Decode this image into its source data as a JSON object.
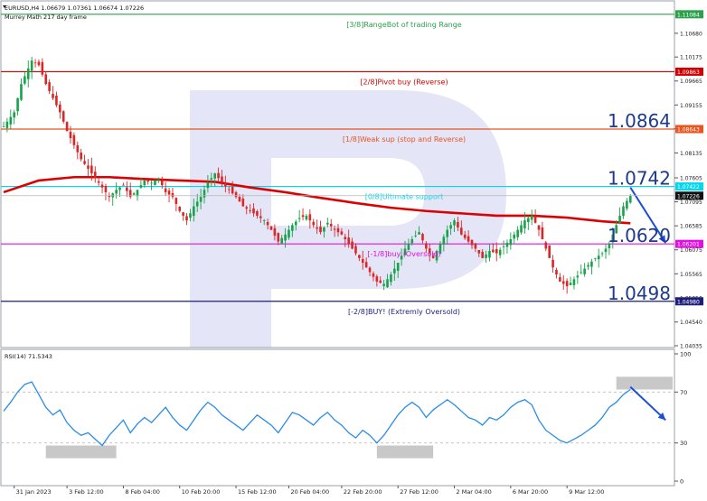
{
  "header": {
    "symbol_line": "EURUSD,H4  1.06679 1.07361 1.06674 1.07226",
    "indicator_label": "Murrey Math 217 day frame"
  },
  "colors": {
    "bull": "#16a34a",
    "bear": "#dc2626",
    "ma": "#dc0000",
    "rsi": "#2b8ce8",
    "forecast_arrow": "#1d4ed8",
    "watermark": "#e4e5f6"
  },
  "price_axis": {
    "min": 1.04035,
    "max": 1.1133,
    "ticks": [
      "1.10680",
      "1.10175",
      "1.09665",
      "1.09155",
      "1.08650",
      "1.08135",
      "1.07605",
      "1.07095",
      "1.06585",
      "1.06075",
      "1.05565",
      "1.05050",
      "1.04540",
      "1.04035"
    ],
    "current_price": "1.07226",
    "current_price_color": "#6b7280"
  },
  "murrey_levels": [
    {
      "label": "[3/8]RangeBot of trading Range",
      "price": 1.11084,
      "badge": "1.11084",
      "color": "#2aa14a",
      "label_pos": "center"
    },
    {
      "label": "[2/8]Pivot buy (Reverse)",
      "price": 1.09863,
      "badge": "1.09863",
      "color": "#d10000",
      "label_pos": "center"
    },
    {
      "label": "[1/8]Weak sup (stop and Reverse)",
      "price": 1.08643,
      "badge": "1.08643",
      "color": "#e8551e",
      "label_pos": "center"
    },
    {
      "label": "[0/8]Ultimate support",
      "price": 1.07422,
      "badge": "1.07422",
      "color": "#00d8f0",
      "label_pos": "center"
    },
    {
      "label": "[-1/8]buy (Oversold)",
      "price": 1.06201,
      "badge": "1.06201",
      "color": "#e010e0",
      "label_pos": "center"
    },
    {
      "label": "[-2/8]BUY! (Extremly Oversold)",
      "price": 1.0498,
      "badge": "1.04980",
      "color": "#1e1e7a",
      "label_pos": "center"
    }
  ],
  "big_levels": [
    "1.0864",
    "1.0742",
    "1.0620",
    "1.0498"
  ],
  "rsi_panel": {
    "label": "RSI(14) 71.5343",
    "ticks": [
      "100",
      "70",
      "30",
      "0"
    ],
    "min": 0,
    "max": 100
  },
  "time_axis": {
    "labels": [
      "31 Jan 2023",
      "3 Feb 12:00",
      "8 Feb 04:00",
      "10 Feb 20:00",
      "15 Feb 12:00",
      "20 Feb 04:00",
      "22 Feb 20:00",
      "27 Feb 12:00",
      "2 Mar 04:00",
      "6 Mar 20:00",
      "9 Mar 12:00"
    ]
  },
  "chart_data": {
    "type": "candlestick",
    "title": "EURUSD,H4",
    "x_unit": "H4 bar index",
    "price_range": [
      1.04035,
      1.1133
    ],
    "moving_average_label": "Murrey Math 217 day frame",
    "murrey_levels": [
      1.11084,
      1.09863,
      1.08643,
      1.07422,
      1.06201,
      1.0498
    ],
    "close_path": [
      [
        0,
        1.087
      ],
      [
        3,
        1.09
      ],
      [
        5,
        1.096
      ],
      [
        8,
        1.101
      ],
      [
        10,
        1.1
      ],
      [
        12,
        1.096
      ],
      [
        14,
        1.093
      ],
      [
        16,
        1.09
      ],
      [
        18,
        1.086
      ],
      [
        20,
        1.083
      ],
      [
        22,
        1.08
      ],
      [
        24,
        1.078
      ],
      [
        26,
        1.076
      ],
      [
        28,
        1.074
      ],
      [
        30,
        1.072
      ],
      [
        32,
        1.0735
      ],
      [
        34,
        1.0745
      ],
      [
        36,
        1.072
      ],
      [
        38,
        1.0735
      ],
      [
        40,
        1.0755
      ],
      [
        42,
        1.075
      ],
      [
        44,
        1.076
      ],
      [
        46,
        1.073
      ],
      [
        48,
        1.072
      ],
      [
        50,
        1.069
      ],
      [
        52,
        1.067
      ],
      [
        54,
        1.07
      ],
      [
        56,
        1.072
      ],
      [
        58,
        1.075
      ],
      [
        60,
        1.077
      ],
      [
        62,
        1.075
      ],
      [
        64,
        1.0735
      ],
      [
        66,
        1.072
      ],
      [
        68,
        1.07
      ],
      [
        70,
        1.069
      ],
      [
        72,
        1.068
      ],
      [
        74,
        1.067
      ],
      [
        76,
        1.065
      ],
      [
        78,
        1.0625
      ],
      [
        80,
        1.064
      ],
      [
        82,
        1.066
      ],
      [
        84,
        1.0675
      ],
      [
        86,
        1.068
      ],
      [
        88,
        1.066
      ],
      [
        90,
        1.0645
      ],
      [
        92,
        1.0665
      ],
      [
        94,
        1.065
      ],
      [
        96,
        1.064
      ],
      [
        98,
        1.062
      ],
      [
        100,
        1.06
      ],
      [
        102,
        1.058
      ],
      [
        104,
        1.056
      ],
      [
        106,
        1.054
      ],
      [
        108,
        1.0535
      ],
      [
        110,
        1.0555
      ],
      [
        112,
        1.058
      ],
      [
        114,
        1.061
      ],
      [
        116,
        1.063
      ],
      [
        118,
        1.0645
      ],
      [
        120,
        1.061
      ],
      [
        122,
        1.059
      ],
      [
        124,
        1.062
      ],
      [
        126,
        1.065
      ],
      [
        128,
        1.067
      ],
      [
        130,
        1.064
      ],
      [
        132,
        1.0625
      ],
      [
        134,
        1.061
      ],
      [
        136,
        1.059
      ],
      [
        138,
        1.0605
      ],
      [
        140,
        1.06
      ],
      [
        142,
        1.0615
      ],
      [
        144,
        1.063
      ],
      [
        146,
        1.065
      ],
      [
        148,
        1.067
      ],
      [
        150,
        1.068
      ],
      [
        152,
        1.065
      ],
      [
        154,
        1.061
      ],
      [
        156,
        1.057
      ],
      [
        158,
        1.054
      ],
      [
        160,
        1.053
      ],
      [
        162,
        1.0545
      ],
      [
        164,
        1.056
      ],
      [
        166,
        1.0575
      ],
      [
        168,
        1.059
      ],
      [
        170,
        1.06
      ],
      [
        172,
        1.062
      ],
      [
        174,
        1.066
      ],
      [
        176,
        1.07
      ],
      [
        178,
        1.0723
      ]
    ],
    "moving_average": [
      [
        0,
        1.073
      ],
      [
        10,
        1.0755
      ],
      [
        20,
        1.0762
      ],
      [
        30,
        1.0762
      ],
      [
        40,
        1.0758
      ],
      [
        50,
        1.0755
      ],
      [
        60,
        1.0752
      ],
      [
        70,
        1.074
      ],
      [
        80,
        1.073
      ],
      [
        90,
        1.0718
      ],
      [
        100,
        1.0707
      ],
      [
        110,
        1.0697
      ],
      [
        120,
        1.069
      ],
      [
        130,
        1.0685
      ],
      [
        140,
        1.068
      ],
      [
        150,
        1.068
      ],
      [
        160,
        1.0676
      ],
      [
        170,
        1.0668
      ],
      [
        178,
        1.0664
      ]
    ],
    "forecast": {
      "from": [
        178,
        1.074
      ],
      "to": [
        188,
        1.0622
      ],
      "direction": "down"
    },
    "rsi": {
      "name": "RSI(14)",
      "last": 71.5343,
      "levels": [
        70,
        30
      ],
      "values": [
        [
          0,
          55
        ],
        [
          2,
          62
        ],
        [
          4,
          70
        ],
        [
          6,
          76
        ],
        [
          8,
          78
        ],
        [
          10,
          68
        ],
        [
          12,
          58
        ],
        [
          14,
          52
        ],
        [
          16,
          56
        ],
        [
          18,
          46
        ],
        [
          20,
          40
        ],
        [
          22,
          36
        ],
        [
          24,
          38
        ],
        [
          26,
          33
        ],
        [
          28,
          28
        ],
        [
          30,
          36
        ],
        [
          32,
          42
        ],
        [
          34,
          48
        ],
        [
          36,
          38
        ],
        [
          38,
          45
        ],
        [
          40,
          50
        ],
        [
          42,
          46
        ],
        [
          44,
          52
        ],
        [
          46,
          58
        ],
        [
          48,
          50
        ],
        [
          50,
          44
        ],
        [
          52,
          40
        ],
        [
          54,
          48
        ],
        [
          56,
          56
        ],
        [
          58,
          62
        ],
        [
          60,
          58
        ],
        [
          62,
          52
        ],
        [
          64,
          48
        ],
        [
          66,
          44
        ],
        [
          68,
          40
        ],
        [
          70,
          46
        ],
        [
          72,
          52
        ],
        [
          74,
          48
        ],
        [
          76,
          44
        ],
        [
          78,
          38
        ],
        [
          80,
          46
        ],
        [
          82,
          54
        ],
        [
          84,
          52
        ],
        [
          86,
          48
        ],
        [
          88,
          44
        ],
        [
          90,
          50
        ],
        [
          92,
          54
        ],
        [
          94,
          48
        ],
        [
          96,
          44
        ],
        [
          98,
          38
        ],
        [
          100,
          34
        ],
        [
          102,
          40
        ],
        [
          104,
          36
        ],
        [
          106,
          30
        ],
        [
          108,
          36
        ],
        [
          110,
          44
        ],
        [
          112,
          52
        ],
        [
          114,
          58
        ],
        [
          116,
          62
        ],
        [
          118,
          58
        ],
        [
          120,
          50
        ],
        [
          122,
          56
        ],
        [
          124,
          60
        ],
        [
          126,
          64
        ],
        [
          128,
          60
        ],
        [
          130,
          55
        ],
        [
          132,
          50
        ],
        [
          134,
          48
        ],
        [
          136,
          44
        ],
        [
          138,
          50
        ],
        [
          140,
          48
        ],
        [
          142,
          52
        ],
        [
          144,
          58
        ],
        [
          146,
          62
        ],
        [
          148,
          64
        ],
        [
          150,
          60
        ],
        [
          152,
          48
        ],
        [
          154,
          40
        ],
        [
          156,
          36
        ],
        [
          158,
          32
        ],
        [
          160,
          30
        ],
        [
          162,
          33
        ],
        [
          164,
          36
        ],
        [
          166,
          40
        ],
        [
          168,
          44
        ],
        [
          170,
          50
        ],
        [
          172,
          58
        ],
        [
          174,
          62
        ],
        [
          176,
          68
        ],
        [
          178,
          72
        ]
      ],
      "forecast": {
        "from": [
          178,
          74
        ],
        "to": [
          188,
          48
        ],
        "direction": "down"
      }
    },
    "shaded_zones": [
      {
        "panel": "rsi",
        "x_range": [
          12,
          32
        ],
        "y_range": [
          18,
          28
        ]
      },
      {
        "panel": "rsi",
        "x_range": [
          106,
          122
        ],
        "y_range": [
          18,
          28
        ]
      },
      {
        "panel": "rsi",
        "x_range": [
          174,
          190
        ],
        "y_range": [
          72,
          82
        ]
      }
    ]
  }
}
